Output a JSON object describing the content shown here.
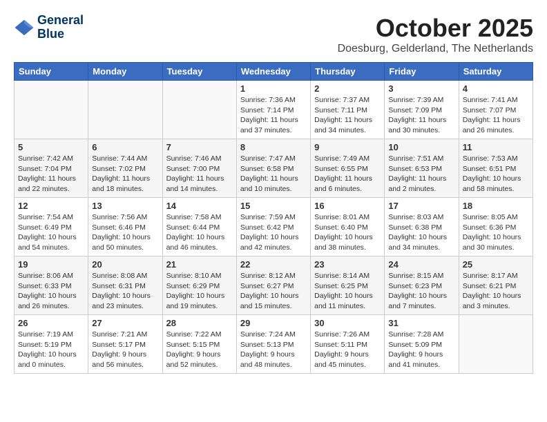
{
  "header": {
    "logo_line1": "General",
    "logo_line2": "Blue",
    "month": "October 2025",
    "location": "Doesburg, Gelderland, The Netherlands"
  },
  "days_of_week": [
    "Sunday",
    "Monday",
    "Tuesday",
    "Wednesday",
    "Thursday",
    "Friday",
    "Saturday"
  ],
  "weeks": [
    [
      {
        "day": "",
        "content": ""
      },
      {
        "day": "",
        "content": ""
      },
      {
        "day": "",
        "content": ""
      },
      {
        "day": "1",
        "content": "Sunrise: 7:36 AM\nSunset: 7:14 PM\nDaylight: 11 hours and 37 minutes."
      },
      {
        "day": "2",
        "content": "Sunrise: 7:37 AM\nSunset: 7:11 PM\nDaylight: 11 hours and 34 minutes."
      },
      {
        "day": "3",
        "content": "Sunrise: 7:39 AM\nSunset: 7:09 PM\nDaylight: 11 hours and 30 minutes."
      },
      {
        "day": "4",
        "content": "Sunrise: 7:41 AM\nSunset: 7:07 PM\nDaylight: 11 hours and 26 minutes."
      }
    ],
    [
      {
        "day": "5",
        "content": "Sunrise: 7:42 AM\nSunset: 7:04 PM\nDaylight: 11 hours and 22 minutes."
      },
      {
        "day": "6",
        "content": "Sunrise: 7:44 AM\nSunset: 7:02 PM\nDaylight: 11 hours and 18 minutes."
      },
      {
        "day": "7",
        "content": "Sunrise: 7:46 AM\nSunset: 7:00 PM\nDaylight: 11 hours and 14 minutes."
      },
      {
        "day": "8",
        "content": "Sunrise: 7:47 AM\nSunset: 6:58 PM\nDaylight: 11 hours and 10 minutes."
      },
      {
        "day": "9",
        "content": "Sunrise: 7:49 AM\nSunset: 6:55 PM\nDaylight: 11 hours and 6 minutes."
      },
      {
        "day": "10",
        "content": "Sunrise: 7:51 AM\nSunset: 6:53 PM\nDaylight: 11 hours and 2 minutes."
      },
      {
        "day": "11",
        "content": "Sunrise: 7:53 AM\nSunset: 6:51 PM\nDaylight: 10 hours and 58 minutes."
      }
    ],
    [
      {
        "day": "12",
        "content": "Sunrise: 7:54 AM\nSunset: 6:49 PM\nDaylight: 10 hours and 54 minutes."
      },
      {
        "day": "13",
        "content": "Sunrise: 7:56 AM\nSunset: 6:46 PM\nDaylight: 10 hours and 50 minutes."
      },
      {
        "day": "14",
        "content": "Sunrise: 7:58 AM\nSunset: 6:44 PM\nDaylight: 10 hours and 46 minutes."
      },
      {
        "day": "15",
        "content": "Sunrise: 7:59 AM\nSunset: 6:42 PM\nDaylight: 10 hours and 42 minutes."
      },
      {
        "day": "16",
        "content": "Sunrise: 8:01 AM\nSunset: 6:40 PM\nDaylight: 10 hours and 38 minutes."
      },
      {
        "day": "17",
        "content": "Sunrise: 8:03 AM\nSunset: 6:38 PM\nDaylight: 10 hours and 34 minutes."
      },
      {
        "day": "18",
        "content": "Sunrise: 8:05 AM\nSunset: 6:36 PM\nDaylight: 10 hours and 30 minutes."
      }
    ],
    [
      {
        "day": "19",
        "content": "Sunrise: 8:06 AM\nSunset: 6:33 PM\nDaylight: 10 hours and 26 minutes."
      },
      {
        "day": "20",
        "content": "Sunrise: 8:08 AM\nSunset: 6:31 PM\nDaylight: 10 hours and 23 minutes."
      },
      {
        "day": "21",
        "content": "Sunrise: 8:10 AM\nSunset: 6:29 PM\nDaylight: 10 hours and 19 minutes."
      },
      {
        "day": "22",
        "content": "Sunrise: 8:12 AM\nSunset: 6:27 PM\nDaylight: 10 hours and 15 minutes."
      },
      {
        "day": "23",
        "content": "Sunrise: 8:14 AM\nSunset: 6:25 PM\nDaylight: 10 hours and 11 minutes."
      },
      {
        "day": "24",
        "content": "Sunrise: 8:15 AM\nSunset: 6:23 PM\nDaylight: 10 hours and 7 minutes."
      },
      {
        "day": "25",
        "content": "Sunrise: 8:17 AM\nSunset: 6:21 PM\nDaylight: 10 hours and 3 minutes."
      }
    ],
    [
      {
        "day": "26",
        "content": "Sunrise: 7:19 AM\nSunset: 5:19 PM\nDaylight: 10 hours and 0 minutes."
      },
      {
        "day": "27",
        "content": "Sunrise: 7:21 AM\nSunset: 5:17 PM\nDaylight: 9 hours and 56 minutes."
      },
      {
        "day": "28",
        "content": "Sunrise: 7:22 AM\nSunset: 5:15 PM\nDaylight: 9 hours and 52 minutes."
      },
      {
        "day": "29",
        "content": "Sunrise: 7:24 AM\nSunset: 5:13 PM\nDaylight: 9 hours and 48 minutes."
      },
      {
        "day": "30",
        "content": "Sunrise: 7:26 AM\nSunset: 5:11 PM\nDaylight: 9 hours and 45 minutes."
      },
      {
        "day": "31",
        "content": "Sunrise: 7:28 AM\nSunset: 5:09 PM\nDaylight: 9 hours and 41 minutes."
      },
      {
        "day": "",
        "content": ""
      }
    ]
  ]
}
